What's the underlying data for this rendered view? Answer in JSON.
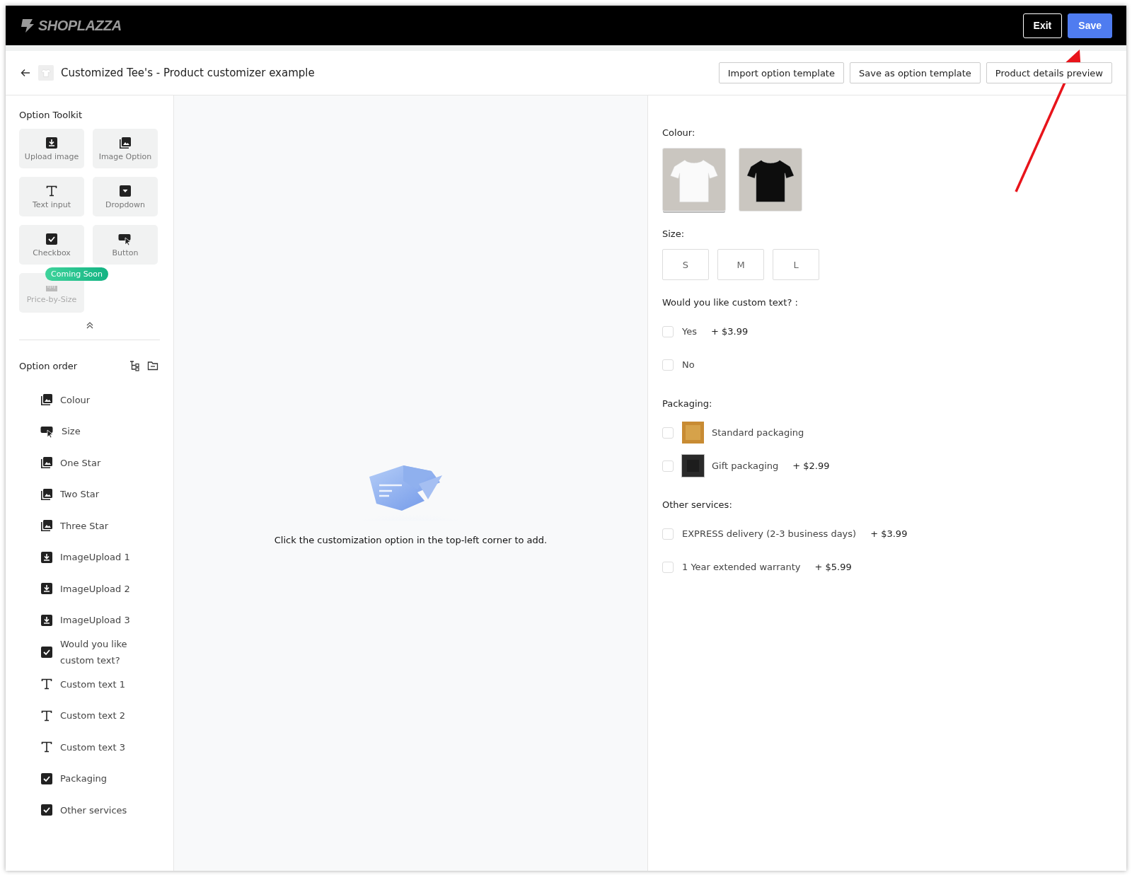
{
  "topbar": {
    "logo": "SHOPLAZZA",
    "buttons": [
      {
        "label": "Exit",
        "kind": "outline"
      },
      {
        "label": "Save",
        "kind": "primary"
      }
    ]
  },
  "header": {
    "title": "Customized Tee's - Product customizer example",
    "buttons": [
      "Import option template",
      "Save as option template",
      "Product details preview"
    ]
  },
  "toolkit": {
    "title": "Option Toolkit",
    "items": [
      {
        "label": "Upload image",
        "kind": "upload",
        "disabled": false
      },
      {
        "label": "Image Option",
        "kind": "image",
        "disabled": false
      },
      {
        "label": "Text input",
        "kind": "text",
        "disabled": false
      },
      {
        "label": "Dropdown",
        "kind": "dropdown",
        "disabled": false
      },
      {
        "label": "Checkbox",
        "kind": "checkbox",
        "disabled": false
      },
      {
        "label": "Button",
        "kind": "button",
        "disabled": false
      },
      {
        "label": "Price-by-Size",
        "kind": "ruler",
        "disabled": true,
        "badge": "Coming Soon"
      }
    ]
  },
  "option_order": {
    "title": "Option order",
    "items": [
      {
        "label": "Colour",
        "kind": "image"
      },
      {
        "label": "Size",
        "kind": "button"
      },
      {
        "label": "One Star",
        "kind": "image"
      },
      {
        "label": "Two Star",
        "kind": "image"
      },
      {
        "label": "Three Star",
        "kind": "image"
      },
      {
        "label": "ImageUpload 1",
        "kind": "upload"
      },
      {
        "label": "ImageUpload 2",
        "kind": "upload"
      },
      {
        "label": "ImageUpload 3",
        "kind": "upload"
      },
      {
        "label": "Would you like custom text?",
        "kind": "checkbox"
      },
      {
        "label": "Custom text 1",
        "kind": "text"
      },
      {
        "label": "Custom text 2",
        "kind": "text"
      },
      {
        "label": "Custom text 3",
        "kind": "text"
      },
      {
        "label": "Packaging",
        "kind": "checkbox"
      },
      {
        "label": "Other services",
        "kind": "checkbox"
      }
    ]
  },
  "canvas": {
    "message": "Click the customization option in the top-left corner to add."
  },
  "preview": {
    "sections": [
      {
        "label": "Colour:",
        "kind": "swatches",
        "options": [
          {
            "kind": "light_shirt",
            "selected": true
          },
          {
            "kind": "dark_shirt",
            "selected": false
          }
        ]
      },
      {
        "label": "Size:",
        "kind": "buttons",
        "options": [
          {
            "label": "S",
            "selected": false
          },
          {
            "label": "M",
            "selected": false
          },
          {
            "label": "L",
            "selected": false
          }
        ]
      },
      {
        "label": "Would you like custom text? :",
        "kind": "checkboxes",
        "options": [
          {
            "label": "Yes",
            "price": "+ $3.99",
            "checked": false
          },
          {
            "label": "No",
            "checked": false
          }
        ]
      },
      {
        "label": "Packaging:",
        "kind": "checkboxes",
        "options": [
          {
            "label": "Standard packaging",
            "kind": "framed_photo",
            "checked": false
          },
          {
            "label": "Gift packaging",
            "kind": "boxed_photo",
            "price": "+ $2.99",
            "checked": false
          }
        ]
      },
      {
        "label": "Other services:",
        "kind": "checkboxes",
        "options": [
          {
            "label": "EXPRESS delivery (2-3 business days)",
            "price": "+ $3.99",
            "checked": false
          },
          {
            "label": "1 Year extended warranty",
            "price": "+ $5.99",
            "checked": false
          }
        ]
      }
    ]
  }
}
